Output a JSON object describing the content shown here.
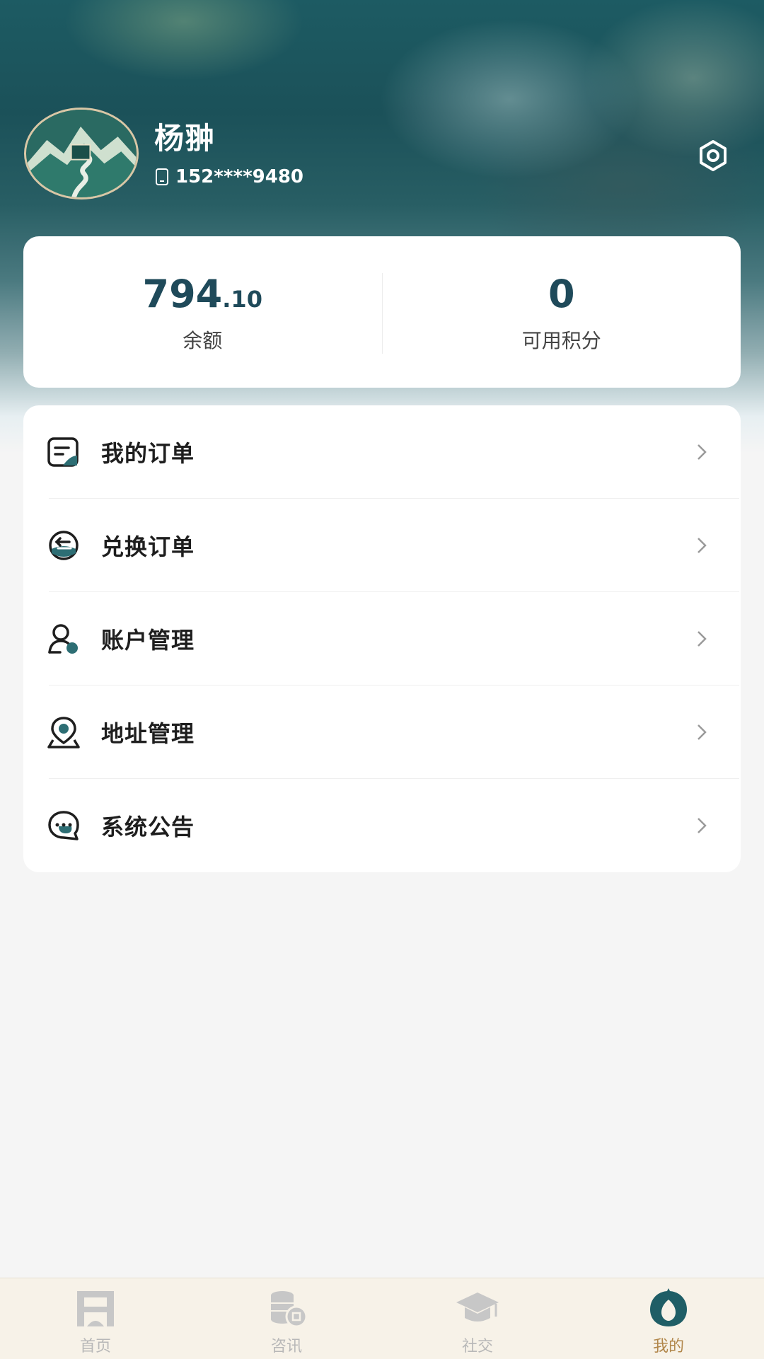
{
  "profile": {
    "name": "杨翀",
    "phone": "152****9480"
  },
  "stats": {
    "balance_int": "794",
    "balance_dec": ".10",
    "balance_label": "余额",
    "points_value": "0",
    "points_label": "可用积分"
  },
  "menu": {
    "items": [
      {
        "label": "我的订单",
        "icon": "order-icon"
      },
      {
        "label": "兑换订单",
        "icon": "exchange-icon"
      },
      {
        "label": "账户管理",
        "icon": "account-icon"
      },
      {
        "label": "地址管理",
        "icon": "location-icon"
      },
      {
        "label": "系统公告",
        "icon": "announcement-icon"
      }
    ]
  },
  "tabbar": {
    "items": [
      {
        "label": "首页",
        "icon": "home-icon",
        "active": false
      },
      {
        "label": "咨讯",
        "icon": "coins-icon",
        "active": false
      },
      {
        "label": "社交",
        "icon": "graduation-cap-icon",
        "active": false
      },
      {
        "label": "我的",
        "icon": "profile-logo-icon",
        "active": true
      }
    ]
  },
  "colors": {
    "accent": "#1f4a5a",
    "icon_teal": "#2d6e74",
    "tab_active": "#b1864a",
    "tab_inactive": "#b8b8b8"
  }
}
